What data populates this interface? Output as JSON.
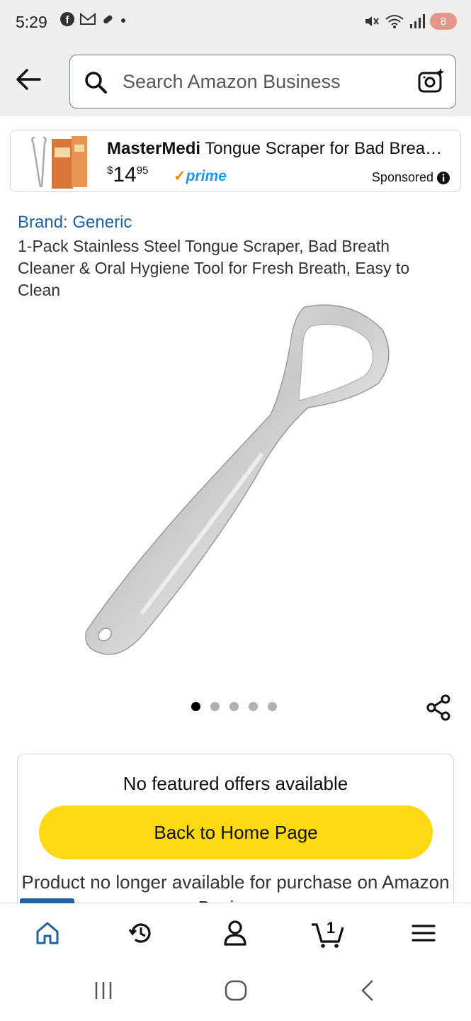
{
  "status_bar": {
    "time": "5:29",
    "battery": "8",
    "icons": [
      "facebook-icon",
      "gmail-icon",
      "pill-icon",
      "dot-icon",
      "mute-icon",
      "wifi-icon",
      "signal-icon"
    ]
  },
  "search": {
    "placeholder": "Search Amazon Business"
  },
  "sponsored": {
    "brand": "MasterMedi",
    "title_rest": " Tongue Scraper for Bad Brea…",
    "price_currency": "$",
    "price_whole": "14",
    "price_fraction": "95",
    "prime": "prime",
    "sponsored_label": "Sponsored"
  },
  "product": {
    "brand": "Brand: Generic",
    "title": "1-Pack Stainless Steel Tongue Scraper, Bad Breath Cleaner & Oral Hygiene Tool for Fresh Breath, Easy to Clean",
    "image_count": 5,
    "active_image_index": 0
  },
  "offer": {
    "no_offers": "No featured offers available",
    "home_button": "Back to Home Page",
    "unavailable": "Product no longer available for purchase on Amazon Business"
  },
  "tab_bar": {
    "active": "home",
    "tabs": [
      "home-icon",
      "history-icon",
      "account-icon",
      "cart-icon",
      "menu-icon"
    ],
    "cart_count": "1"
  },
  "colors": {
    "accent_link": "#2162a1",
    "button_yellow": "#ffd814",
    "prime_blue": "#1a98ff",
    "prime_check": "#f08804"
  }
}
